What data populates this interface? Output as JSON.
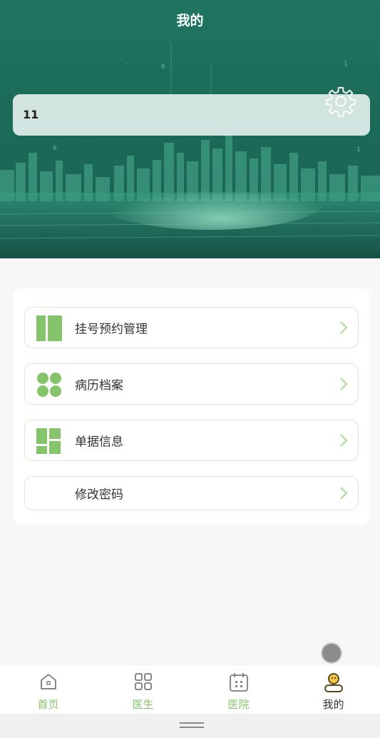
{
  "header": {
    "title": "我的"
  },
  "user": {
    "name": "11"
  },
  "icons": {
    "settings": "gear-icon"
  },
  "menu": {
    "items": [
      {
        "label": "挂号预约管理",
        "icon": "columns-icon"
      },
      {
        "label": "病历档案",
        "icon": "dots-grid-icon"
      },
      {
        "label": "单据信息",
        "icon": "blocks-icon"
      },
      {
        "label": "修改密码",
        "icon": ""
      }
    ]
  },
  "tabbar": {
    "items": [
      {
        "label": "首页",
        "icon": "home-icon"
      },
      {
        "label": "医生",
        "icon": "grid-icon"
      },
      {
        "label": "医院",
        "icon": "calendar-icon"
      },
      {
        "label": "我的",
        "icon": "profile-icon",
        "active": true
      }
    ]
  },
  "colors": {
    "accent": "#86c46b",
    "header_bg": "#1f7560",
    "border": "#d8ecd2"
  }
}
